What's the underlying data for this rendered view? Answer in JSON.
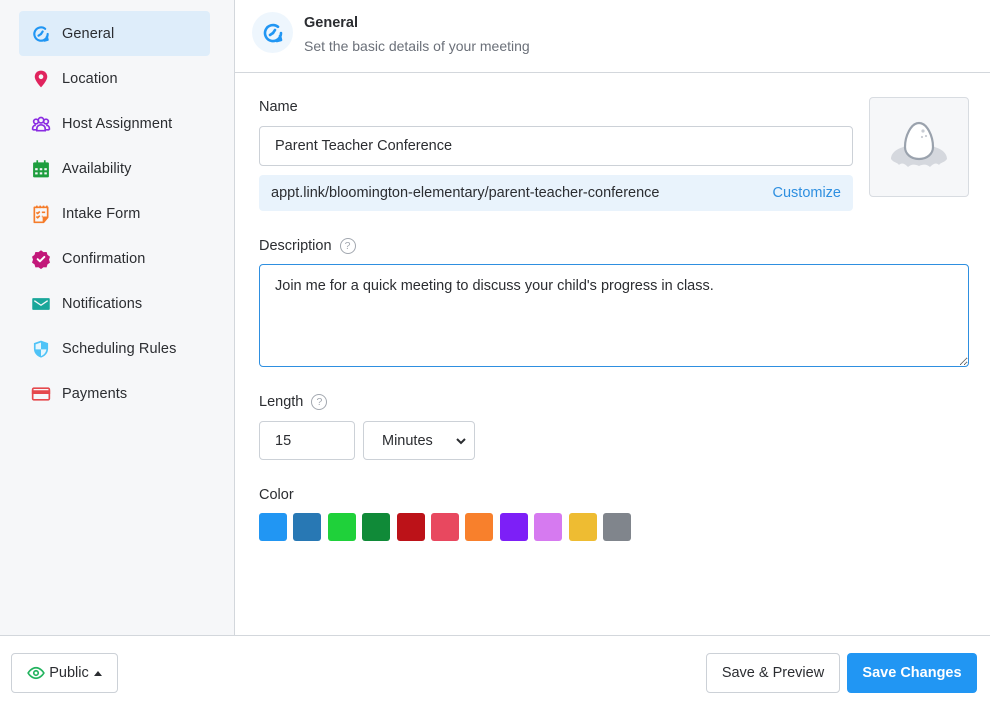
{
  "sidebar": {
    "items": [
      {
        "label": "General",
        "icon": "clock-refresh-icon",
        "color": "#2196f3",
        "active": true
      },
      {
        "label": "Location",
        "icon": "map-pin-icon",
        "color": "#e0245e",
        "active": false
      },
      {
        "label": "Host Assignment",
        "icon": "users-icon",
        "color": "#8a2be2",
        "active": false
      },
      {
        "label": "Availability",
        "icon": "calendar-icon",
        "color": "#1e9e3e",
        "active": false
      },
      {
        "label": "Intake Form",
        "icon": "checklist-icon",
        "color": "#f57c2b",
        "active": false
      },
      {
        "label": "Confirmation",
        "icon": "check-badge-icon",
        "color": "#c2187a",
        "active": false
      },
      {
        "label": "Notifications",
        "icon": "envelope-icon",
        "color": "#19a79a",
        "active": false
      },
      {
        "label": "Scheduling Rules",
        "icon": "shield-icon",
        "color": "#4fc3f7",
        "active": false
      },
      {
        "label": "Payments",
        "icon": "credit-card-icon",
        "color": "#e5484d",
        "active": false
      }
    ]
  },
  "header": {
    "title": "General",
    "subtitle": "Set the basic details of your meeting",
    "icon": "clock-refresh-icon"
  },
  "form": {
    "name_label": "Name",
    "name_value": "Parent Teacher Conference",
    "link_url": "appt.link/bloomington-elementary/parent-teacher-conference",
    "customize_label": "Customize",
    "avatar_icon": "egg-in-nest-icon",
    "description_label": "Description",
    "description_value": "Join me for a quick meeting to discuss your child's progress in class.",
    "help_glyph": "?",
    "length_label": "Length",
    "length_value": "15",
    "length_unit": "Minutes",
    "color_label": "Color",
    "colors": [
      "#2196f3",
      "#2878b4",
      "#1fd13a",
      "#108a38",
      "#bc1218",
      "#e8485f",
      "#f8802c",
      "#7d1ff7",
      "#d67af0",
      "#eebc32",
      "#80858c"
    ]
  },
  "footer": {
    "visibility_label": "Public",
    "preview_label": "Save & Preview",
    "save_label": "Save Changes",
    "visibility_icon_color": "#22b35e"
  }
}
